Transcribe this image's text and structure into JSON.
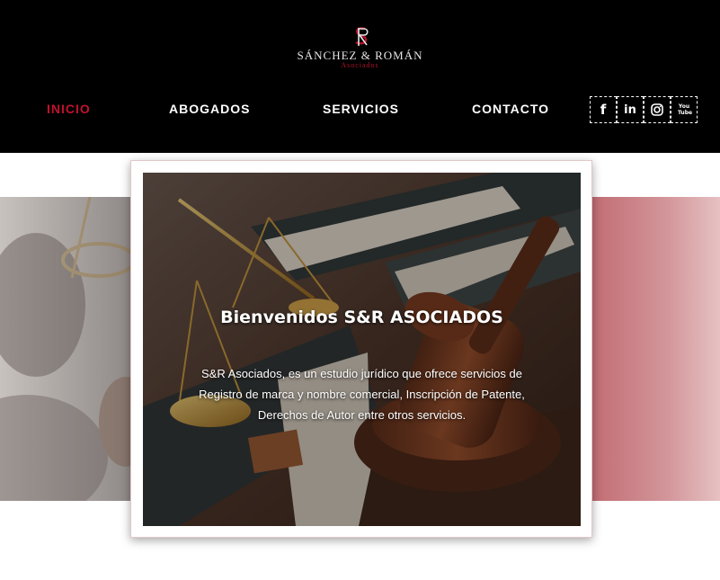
{
  "brand": {
    "mark": "SR",
    "name": "SÁNCHEZ & ROMÁN",
    "subtitle": "Asociados"
  },
  "nav": {
    "items": [
      {
        "label": "INICIO",
        "active": true
      },
      {
        "label": "ABOGADOS",
        "active": false
      },
      {
        "label": "SERVICIOS",
        "active": false
      },
      {
        "label": "CONTACTO",
        "active": false
      }
    ]
  },
  "social": [
    {
      "icon": "facebook-icon",
      "glyph": "f"
    },
    {
      "icon": "linkedin-icon",
      "glyph": "in"
    },
    {
      "icon": "instagram-icon",
      "glyph": ""
    },
    {
      "icon": "youtube-icon",
      "glyph": "You Tube"
    }
  ],
  "hero": {
    "title": "Bienvenidos S&R ASOCIADOS",
    "line1": "S&R Asociados, es un estudio jurídico que ofrece servicios de",
    "line2": "Registro de marca y nombre comercial, Inscripción de Patente,",
    "line3": "Derechos de Autor entre otros servicios."
  },
  "colors": {
    "header_bg": "#000000",
    "accent": "#c0122e",
    "nav_text": "#ffffff"
  }
}
